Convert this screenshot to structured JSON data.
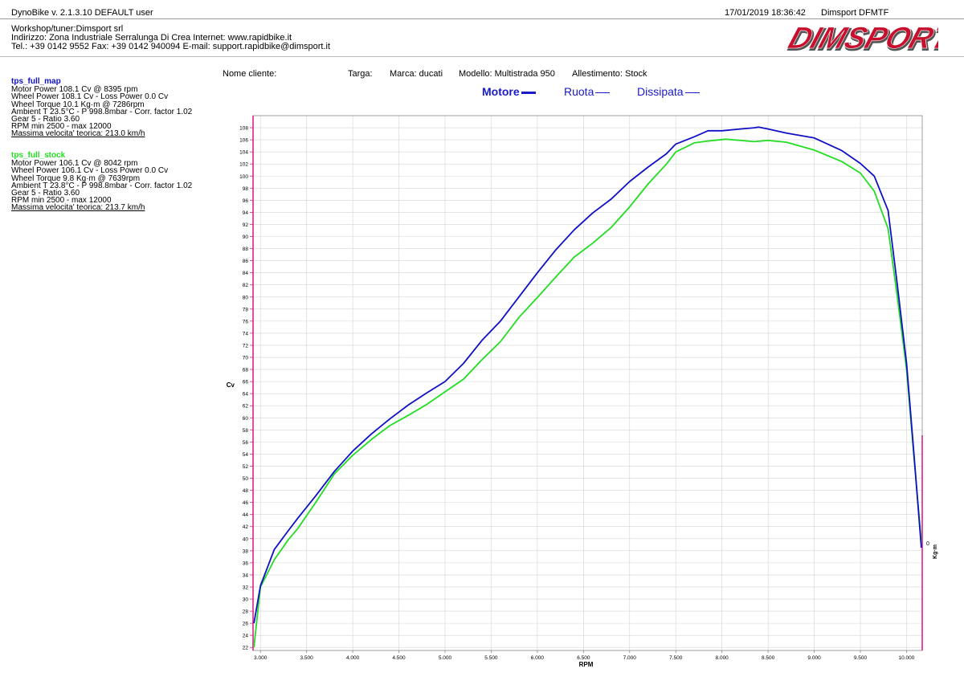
{
  "header": {
    "app_version": "DynoBike v. 2.1.3.10   DEFAULT user",
    "datetime": "17/01/2019 18:36:42",
    "device": "Dimsport DFMTF"
  },
  "workshop": {
    "line1": "Workshop/tuner:Dimsport srl",
    "line2": "Indirizzo: Zona Industriale Serralunga Di Crea Internet: www.rapidbike.it",
    "line3": "Tel.: +39 0142 9552 Fax: +39 0142 940094 E-mail: support.rapidbike@dimsport.it"
  },
  "logo": {
    "text": "DIMSPORT",
    "color": "#c8102e"
  },
  "runs": [
    {
      "title": "tps_full_map",
      "color": "#1010c8",
      "lines": [
        "Motor Power 108.1 Cv  @ 8395 rpm",
        "Wheel Power 108.1 Cv  - Loss Power 0.0 Cv",
        "Wheel Torque 10.1 Kg·m  @ 7286rpm",
        "Ambient T 23.5°C - P 998.8mbar - Corr. factor 1.02",
        "Gear 5 - Ratio 3.60",
        "RPM min 2500 - max 12000"
      ],
      "speed": "Massima velocita' teorica: 213.0 km/h"
    },
    {
      "title": "tps_full_stock",
      "color": "#22dd22",
      "lines": [
        "Motor Power 106.1 Cv  @ 8042 rpm",
        "Wheel Power 106.1 Cv  - Loss Power 0.0 Cv",
        "Wheel Torque 9.8 Kg·m  @ 7639rpm",
        "Ambient T 23.8°C - P 998.8mbar - Corr. factor 1.02",
        "Gear 5 - Ratio 3.60",
        "RPM min 2500 - max 12000"
      ],
      "speed": "Massima velocita' teorica: 213.7 km/h"
    }
  ],
  "meta": {
    "cliente": "Nome cliente:",
    "targa": "Targa:",
    "marca": "Marca: ducati",
    "modello": "Modello: Multistrada 950",
    "allestimento": "Allestimento: Stock"
  },
  "tabs": [
    {
      "label": "Motore",
      "active": true
    },
    {
      "label": "Ruota",
      "active": false
    },
    {
      "label": "Dissipata",
      "active": false
    }
  ],
  "colors": {
    "accent": "#1a1ac8",
    "axis_magenta": "#e0208a",
    "grid": "#d4d4d4"
  },
  "chart_data": {
    "type": "line",
    "xlabel": "RPM",
    "ylabel": "Cv",
    "ylabel_right": "Kg·m",
    "right_tick": "0",
    "xlim": [
      2920,
      10170
    ],
    "ylim": [
      21.5,
      110
    ],
    "x_ticks": [
      "3.000",
      "3.500",
      "4.000",
      "4.500",
      "5.000",
      "5.500",
      "6.000",
      "6.500",
      "7.000",
      "7.500",
      "8.000",
      "8.500",
      "9.000",
      "9.500",
      "10.000"
    ],
    "x_tick_values": [
      3000,
      3500,
      4000,
      4500,
      5000,
      5500,
      6000,
      6500,
      7000,
      7500,
      8000,
      8500,
      9000,
      9500,
      10000
    ],
    "y_ticks": [
      22,
      24,
      26,
      28,
      30,
      32,
      34,
      36,
      38,
      40,
      42,
      44,
      46,
      48,
      50,
      52,
      54,
      56,
      58,
      60,
      62,
      64,
      66,
      68,
      70,
      72,
      74,
      76,
      78,
      80,
      82,
      84,
      86,
      88,
      90,
      92,
      94,
      96,
      98,
      100,
      102,
      104,
      106,
      108
    ],
    "grid": true,
    "series": [
      {
        "name": "tps_full_map",
        "color": "#1010c8",
        "x": [
          2930,
          3000,
          3150,
          3300,
          3400,
          3600,
          3800,
          4000,
          4200,
          4400,
          4600,
          4800,
          5000,
          5200,
          5400,
          5600,
          5800,
          6000,
          6200,
          6400,
          6600,
          6800,
          7000,
          7200,
          7400,
          7500,
          7700,
          7850,
          8000,
          8200,
          8350,
          8395,
          8500,
          8700,
          9000,
          9300,
          9500,
          9650,
          9800,
          9900,
          10000,
          10080,
          10160
        ],
        "y": [
          26,
          32.2,
          38.2,
          41.3,
          43.3,
          47.1,
          51.1,
          54.5,
          57.3,
          59.8,
          62.1,
          64.1,
          66.0,
          69.0,
          72.8,
          76.0,
          80.0,
          84.0,
          87.8,
          91.1,
          93.9,
          96.2,
          99.1,
          101.5,
          103.7,
          105.3,
          106.5,
          107.5,
          107.5,
          107.8,
          108.0,
          108.1,
          107.8,
          107.1,
          106.3,
          104.2,
          102.1,
          100.0,
          94.3,
          82.0,
          69.0,
          54.0,
          38.5
        ]
      },
      {
        "name": "tps_full_stock",
        "color": "#22dd22",
        "x": [
          2930,
          3000,
          3150,
          3300,
          3400,
          3600,
          3800,
          4000,
          4200,
          4400,
          4600,
          4800,
          5000,
          5200,
          5400,
          5600,
          5800,
          6000,
          6200,
          6400,
          6600,
          6800,
          7000,
          7200,
          7400,
          7500,
          7700,
          7850,
          8042,
          8200,
          8350,
          8500,
          8700,
          9000,
          9300,
          9500,
          9650,
          9800,
          9900,
          10000,
          10080,
          10160
        ],
        "y": [
          22,
          32.0,
          36.5,
          39.8,
          41.6,
          46.0,
          50.7,
          53.8,
          56.4,
          58.7,
          60.4,
          62.2,
          64.3,
          66.4,
          69.6,
          72.6,
          76.6,
          79.9,
          83.3,
          86.6,
          88.9,
          91.5,
          94.9,
          98.7,
          102.0,
          104.0,
          105.5,
          105.8,
          106.1,
          105.9,
          105.7,
          105.9,
          105.6,
          104.3,
          102.4,
          100.5,
          97.5,
          91.3,
          80.0,
          68.0,
          53.5,
          39.5
        ]
      }
    ]
  }
}
